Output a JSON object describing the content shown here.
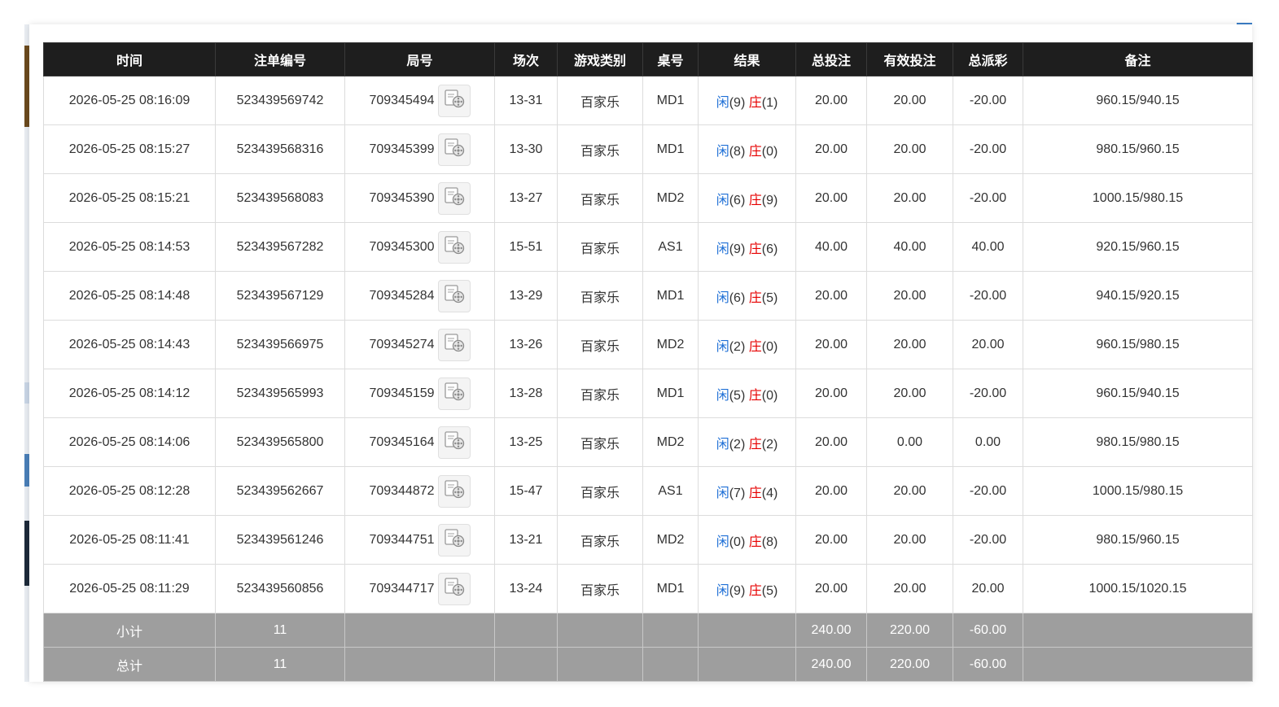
{
  "colors": {
    "header_bg": "#1e1e1e",
    "footer_bg": "#9e9e9e",
    "player_blue": "#1e6fd6",
    "banker_red": "#e60000"
  },
  "table": {
    "headers": [
      "时间",
      "注单编号",
      "局号",
      "场次",
      "游戏类别",
      "桌号",
      "结果",
      "总投注",
      "有效投注",
      "总派彩",
      "备注"
    ],
    "result_labels": {
      "player": "闲",
      "banker": "庄"
    },
    "replay_icon": "video-replay-icon",
    "rows": [
      {
        "time": "2026-05-25 08:16:09",
        "bet_id": "523439569742",
        "round": "709345494",
        "session": "13-31",
        "game": "百家乐",
        "table": "MD1",
        "player": "9",
        "banker": "1",
        "total_bet": "20.00",
        "valid_bet": "20.00",
        "payout": "-20.00",
        "payout_negative": true,
        "note": "960.15/940.15"
      },
      {
        "time": "2026-05-25 08:15:27",
        "bet_id": "523439568316",
        "round": "709345399",
        "session": "13-30",
        "game": "百家乐",
        "table": "MD1",
        "player": "8",
        "banker": "0",
        "total_bet": "20.00",
        "valid_bet": "20.00",
        "payout": "-20.00",
        "payout_negative": true,
        "note": "980.15/960.15"
      },
      {
        "time": "2026-05-25 08:15:21",
        "bet_id": "523439568083",
        "round": "709345390",
        "session": "13-27",
        "game": "百家乐",
        "table": "MD2",
        "player": "6",
        "banker": "9",
        "total_bet": "20.00",
        "valid_bet": "20.00",
        "payout": "-20.00",
        "payout_negative": true,
        "note": "1000.15/980.15"
      },
      {
        "time": "2026-05-25 08:14:53",
        "bet_id": "523439567282",
        "round": "709345300",
        "session": "15-51",
        "game": "百家乐",
        "table": "AS1",
        "player": "9",
        "banker": "6",
        "total_bet": "40.00",
        "valid_bet": "40.00",
        "payout": "40.00",
        "payout_negative": false,
        "note": "920.15/960.15"
      },
      {
        "time": "2026-05-25 08:14:48",
        "bet_id": "523439567129",
        "round": "709345284",
        "session": "13-29",
        "game": "百家乐",
        "table": "MD1",
        "player": "6",
        "banker": "5",
        "total_bet": "20.00",
        "valid_bet": "20.00",
        "payout": "-20.00",
        "payout_negative": true,
        "note": "940.15/920.15"
      },
      {
        "time": "2026-05-25 08:14:43",
        "bet_id": "523439566975",
        "round": "709345274",
        "session": "13-26",
        "game": "百家乐",
        "table": "MD2",
        "player": "2",
        "banker": "0",
        "total_bet": "20.00",
        "valid_bet": "20.00",
        "payout": "20.00",
        "payout_negative": false,
        "note": "960.15/980.15"
      },
      {
        "time": "2026-05-25 08:14:12",
        "bet_id": "523439565993",
        "round": "709345159",
        "session": "13-28",
        "game": "百家乐",
        "table": "MD1",
        "player": "5",
        "banker": "0",
        "total_bet": "20.00",
        "valid_bet": "20.00",
        "payout": "-20.00",
        "payout_negative": true,
        "note": "960.15/940.15"
      },
      {
        "time": "2026-05-25 08:14:06",
        "bet_id": "523439565800",
        "round": "709345164",
        "session": "13-25",
        "game": "百家乐",
        "table": "MD2",
        "player": "2",
        "banker": "2",
        "total_bet": "20.00",
        "valid_bet": "0.00",
        "payout": "0.00",
        "payout_negative": false,
        "note": "980.15/980.15"
      },
      {
        "time": "2026-05-25 08:12:28",
        "bet_id": "523439562667",
        "round": "709344872",
        "session": "15-47",
        "game": "百家乐",
        "table": "AS1",
        "player": "7",
        "banker": "4",
        "total_bet": "20.00",
        "valid_bet": "20.00",
        "payout": "-20.00",
        "payout_negative": true,
        "note": "1000.15/980.15"
      },
      {
        "time": "2026-05-25 08:11:41",
        "bet_id": "523439561246",
        "round": "709344751",
        "session": "13-21",
        "game": "百家乐",
        "table": "MD2",
        "player": "0",
        "banker": "8",
        "total_bet": "20.00",
        "valid_bet": "20.00",
        "payout": "-20.00",
        "payout_negative": true,
        "note": "980.15/960.15"
      },
      {
        "time": "2026-05-25 08:11:29",
        "bet_id": "523439560856",
        "round": "709344717",
        "session": "13-24",
        "game": "百家乐",
        "table": "MD1",
        "player": "9",
        "banker": "5",
        "total_bet": "20.00",
        "valid_bet": "20.00",
        "payout": "20.00",
        "payout_negative": false,
        "note": "1000.15/1020.15"
      }
    ],
    "subtotal": {
      "label": "小计",
      "count": "11",
      "total_bet": "240.00",
      "valid_bet": "220.00",
      "payout": "-60.00"
    },
    "grandtotal": {
      "label": "总计",
      "count": "11",
      "total_bet": "240.00",
      "valid_bet": "220.00",
      "payout": "-60.00"
    }
  }
}
